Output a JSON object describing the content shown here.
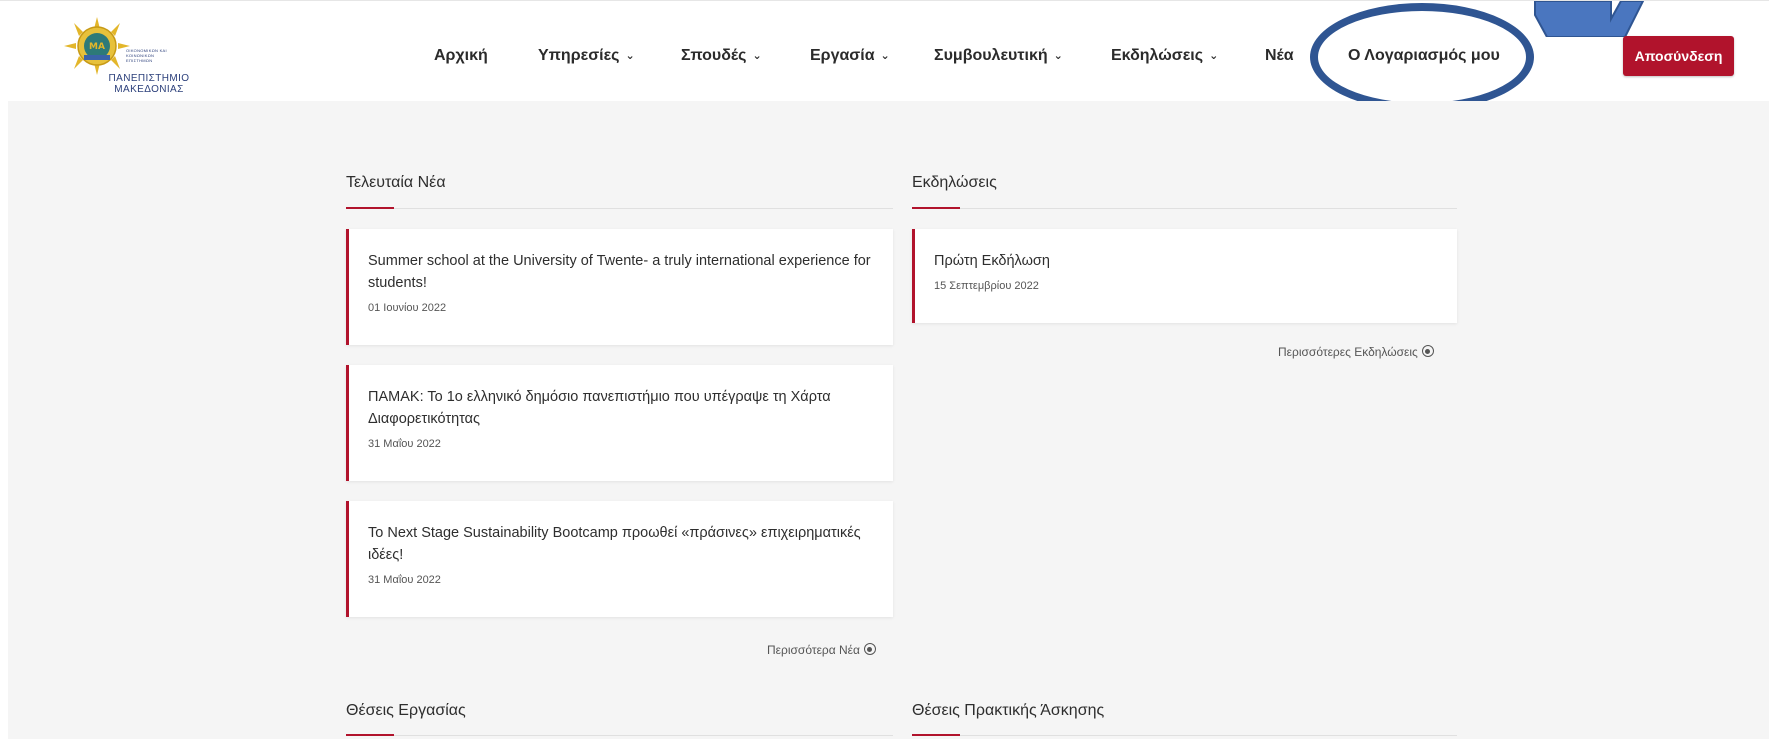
{
  "logo": {
    "text_line1": "ΠΑΝΕΠΙΣΤΗΜΙΟ",
    "text_line2": "ΜΑΚΕΔΟΝΙΑΣ",
    "small_text": "ΟΙΚΟΝΟΜΙΚΩΝ ΚΑΙ ΚΟΙΝΩΝΙΚΩΝ ΕΠΙΣΤΗΜΩΝ",
    "icon": "university-seal-icon"
  },
  "nav": {
    "items": [
      {
        "label": "Αρχική",
        "dropdown": false
      },
      {
        "label": "Υπηρεσίες",
        "dropdown": true
      },
      {
        "label": "Σπουδές",
        "dropdown": true
      },
      {
        "label": "Εργασία",
        "dropdown": true
      },
      {
        "label": "Συμβουλευτική",
        "dropdown": true
      },
      {
        "label": "Εκδηλώσεις",
        "dropdown": true
      },
      {
        "label": "Νέα",
        "dropdown": false
      },
      {
        "label": "Ο Λογαριασμός μου",
        "dropdown": false
      }
    ],
    "chevron": "⌄",
    "logout_label": "Αποσύνδεση"
  },
  "news": {
    "title": "Τελευταία Νέα",
    "items": [
      {
        "title": "Summer school at the University of Twente- a truly international experience for students!",
        "date": "01 Ιουνίου 2022"
      },
      {
        "title": "ΠΑΜΑΚ: Το 1ο ελληνικό δημόσιο πανεπιστήμιο που υπέγραψε τη Χάρτα Διαφορετικότητας",
        "date": "31 Μαΐου 2022"
      },
      {
        "title": "Το Next Stage Sustainability Bootcamp προωθεί «πράσινες» επιχειρηματικές ιδέες!",
        "date": "31 Μαΐου 2022"
      }
    ],
    "more_label": "Περισσότερα Νέα"
  },
  "events": {
    "title": "Εκδηλώσεις",
    "items": [
      {
        "title": "Πρώτη Εκδήλωση",
        "date": "15 Σεπτεμβρίου 2022"
      }
    ],
    "more_label": "Περισσότερες Εκδηλώσεις"
  },
  "jobs": {
    "title": "Θέσεις Εργασίας"
  },
  "internships": {
    "title": "Θέσεις Πρακτικής Άσκησης"
  },
  "colors": {
    "accent": "#b1132c",
    "annotation": "#2f5592",
    "background": "#f5f5f5"
  }
}
